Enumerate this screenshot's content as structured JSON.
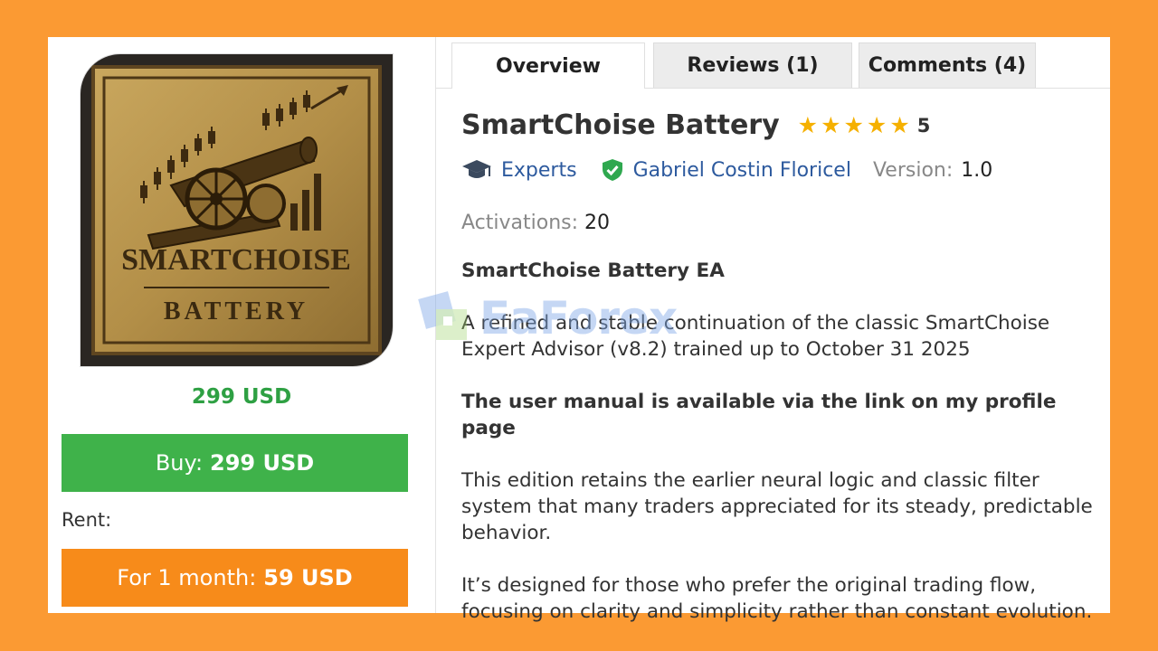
{
  "product": {
    "image_lines": [
      "SMARTCHOISE",
      "BATTERY"
    ],
    "price": "299 USD",
    "buy": {
      "label": "Buy:",
      "amount": "299 USD"
    },
    "rent_label": "Rent:",
    "rent": {
      "label": "For 1 month:",
      "amount": "59 USD"
    }
  },
  "tabs": [
    {
      "label": "Overview"
    },
    {
      "label": "Reviews (1)"
    },
    {
      "label": "Comments (4)"
    }
  ],
  "title": "SmartChoise Battery",
  "rating": {
    "value": "5",
    "stars": 5,
    "color": "#f5b000"
  },
  "meta": {
    "category": "Experts",
    "author": "Gabriel Costin Floricel",
    "version_label": "Version:",
    "version": "1.0",
    "activations_label": "Activations:",
    "activations": "20"
  },
  "description": {
    "heading": "SmartChoise Battery EA",
    "p1": "A refined and stable continuation of the classic SmartChoise Expert Advisor (v8.2) trained up to October 31 2025",
    "p2": "The user manual is available via the link on my profile page",
    "p3": "This edition retains the earlier neural logic and classic filter system that many traders appreciated for its steady, predictable behavior.",
    "p4": "It’s designed for those who prefer the original trading flow, focusing on clarity and simplicity rather than constant evolution."
  },
  "watermark": "EaForex",
  "colors": {
    "background": "#fb9a33",
    "buy": "#3fb24a",
    "rent": "#f78b1a",
    "price": "#2ea043",
    "link": "#2d5a9e"
  }
}
